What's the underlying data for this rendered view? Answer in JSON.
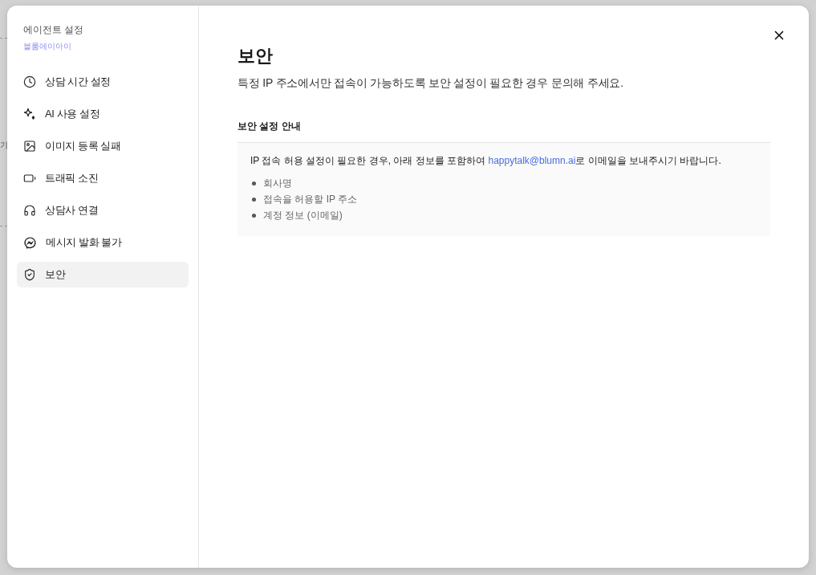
{
  "background_page": {
    "fragment": "기"
  },
  "sidebar": {
    "title": "에이전트 설정",
    "subtitle": "블룸에이아이",
    "items": [
      {
        "label": "상담 시간 설정",
        "kind": "clock",
        "selected": false
      },
      {
        "label": "AI 사용 설정",
        "kind": "sparkle",
        "selected": false
      },
      {
        "label": "이미지 등록 실패",
        "kind": "image",
        "selected": false
      },
      {
        "label": "트래픽 소진",
        "kind": "battery",
        "selected": false
      },
      {
        "label": "상담사 연결",
        "kind": "headphones",
        "selected": false
      },
      {
        "label": "메시지 발화 불가",
        "kind": "chat",
        "selected": false
      },
      {
        "label": "보안",
        "kind": "shield",
        "selected": true
      }
    ]
  },
  "main": {
    "title": "보안",
    "description": "특정 IP 주소에서만 접속이 가능하도록 보안 설정이 필요한 경우 문의해 주세요.",
    "section": {
      "heading": "보안 설정 안내",
      "intro_before": "IP 접속 허용 설정이 필요한 경우, 아래 정보를 포함하여 ",
      "email": "happytalk@blumn.ai",
      "intro_after": "로 이메일을 보내주시기 바랍니다.",
      "bullets": [
        "회사명",
        "접속을 허용할 IP 주소",
        "계정 정보 (이메일)"
      ]
    }
  }
}
